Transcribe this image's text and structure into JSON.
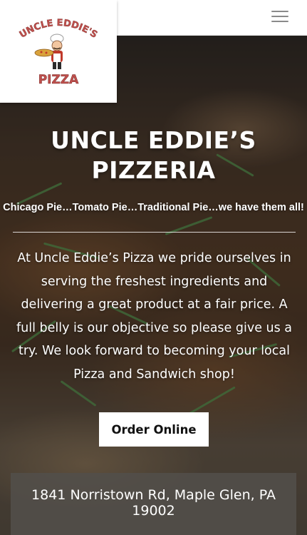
{
  "logo": {
    "top_text": "UNCLE EDDIE'S",
    "bottom_text": "PIZZA"
  },
  "header": {
    "menu_icon": "hamburger-menu-icon"
  },
  "hero": {
    "title_line1": "UNCLE EDDIE’S",
    "title_line2": "PIZZERIA",
    "tagline": "Chicago Pie…Tomato Pie…Traditional Pie…we have them all!",
    "description": "At Uncle Eddie’s Pizza we pride ourselves in serving the freshest ingredients and delivering a great product at a fair price. A full belly is our objective so please give us a try. We look forward to becoming your local Pizza and Sandwich shop!",
    "order_button": "Order Online"
  },
  "address": {
    "line1": "1841 Norristown Rd, Maple Glen, PA",
    "line2": "19002"
  },
  "colors": {
    "logo_text": "#c0504d",
    "logo_accent": "#d9a23c",
    "overlay": "#524e4a"
  }
}
